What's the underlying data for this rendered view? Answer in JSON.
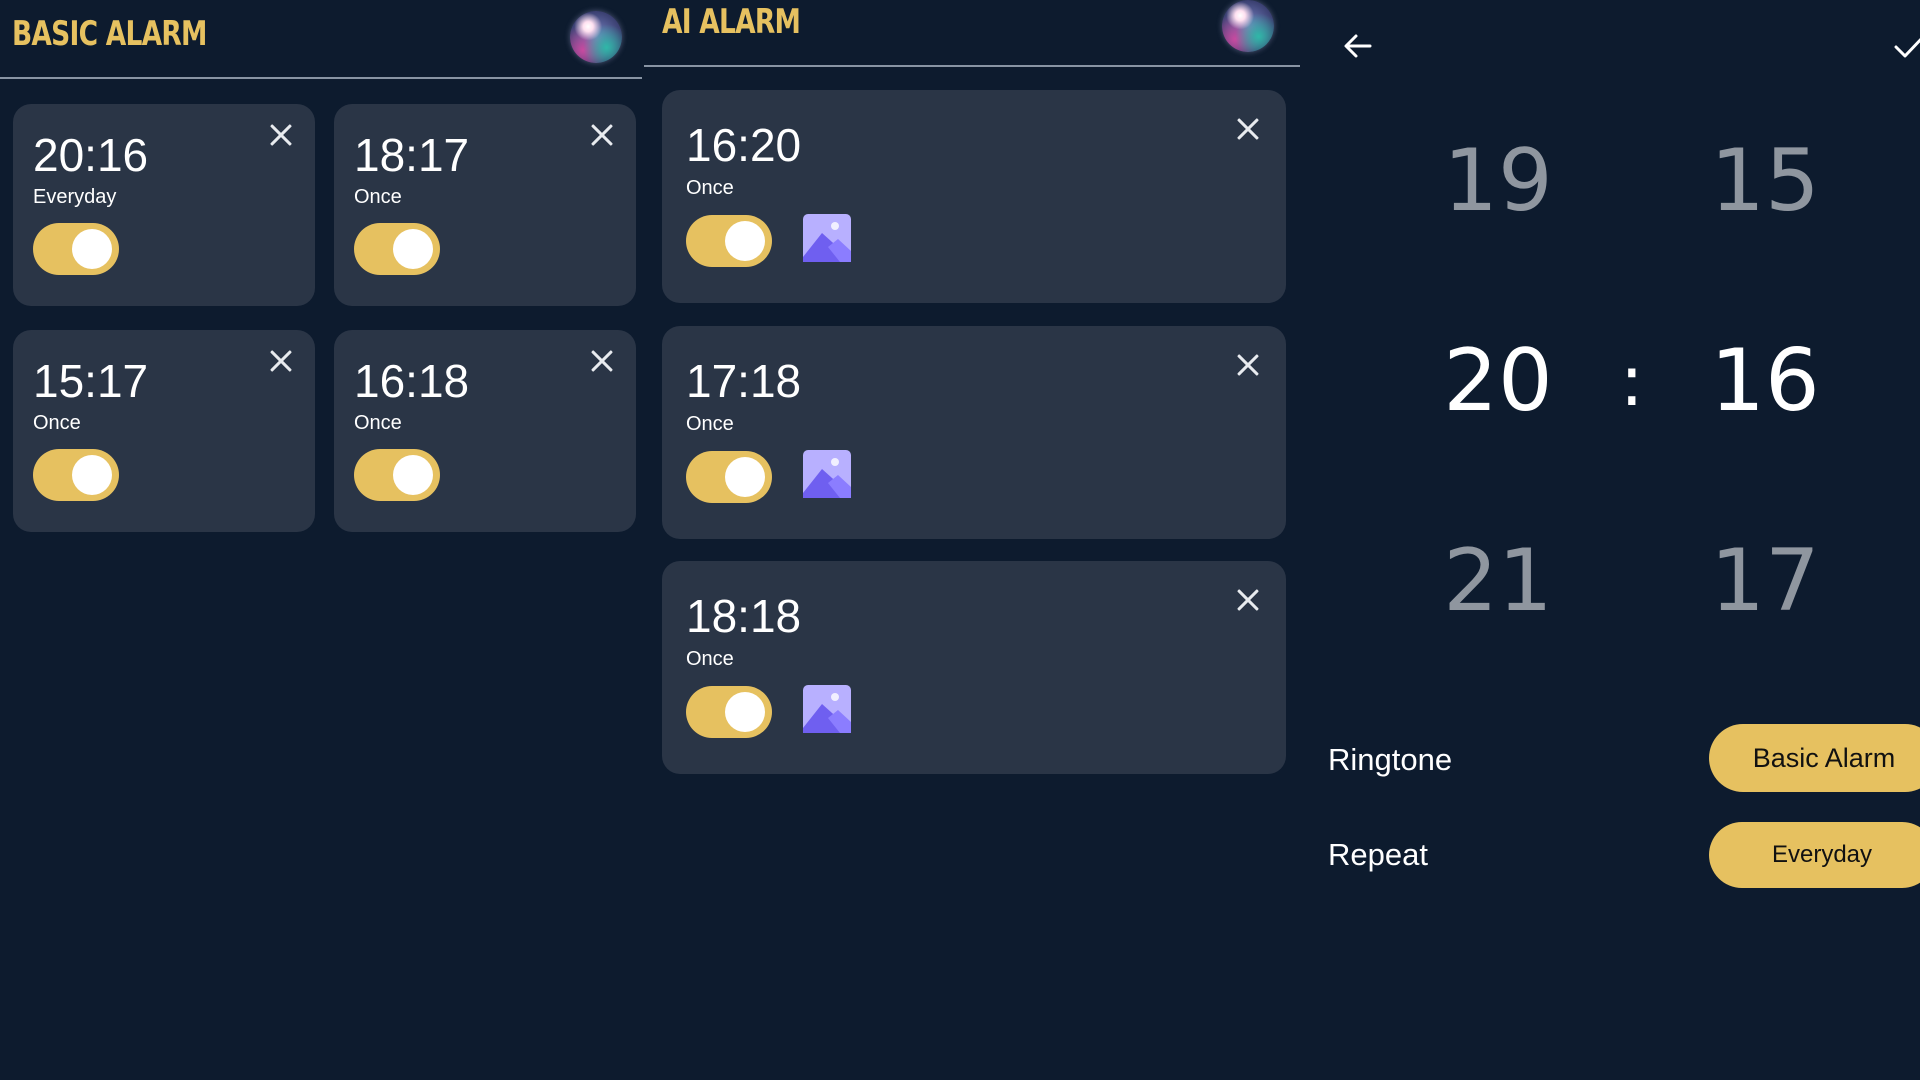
{
  "basic_panel": {
    "title": "BASIC ALARM",
    "alarms": [
      {
        "time": "20:16",
        "repeat": "Everyday",
        "enabled": true
      },
      {
        "time": "18:17",
        "repeat": "Once",
        "enabled": true
      },
      {
        "time": "15:17",
        "repeat": "Once",
        "enabled": true
      },
      {
        "time": "16:18",
        "repeat": "Once",
        "enabled": true
      }
    ]
  },
  "ai_panel": {
    "title": "AI ALARM",
    "alarms": [
      {
        "time": "16:20",
        "repeat": "Once",
        "enabled": true,
        "icon": "image-icon"
      },
      {
        "time": "17:18",
        "repeat": "Once",
        "enabled": true,
        "icon": "image-icon"
      },
      {
        "time": "18:18",
        "repeat": "Once",
        "enabled": true,
        "icon": "image-icon"
      }
    ]
  },
  "editor": {
    "hours": {
      "prev": "19",
      "selected": "20",
      "next": "21"
    },
    "separator": ":",
    "minutes": {
      "prev": "15",
      "selected": "16",
      "next": "17"
    },
    "ringtone": {
      "label": "Ringtone",
      "value": "Basic Alarm"
    },
    "repeat": {
      "label": "Repeat",
      "value": "Everyday"
    }
  },
  "colors": {
    "background": "#0d1b2e",
    "card": "#2a3546",
    "accent": "#e6c160",
    "image_icon": "#6f5ff0"
  }
}
